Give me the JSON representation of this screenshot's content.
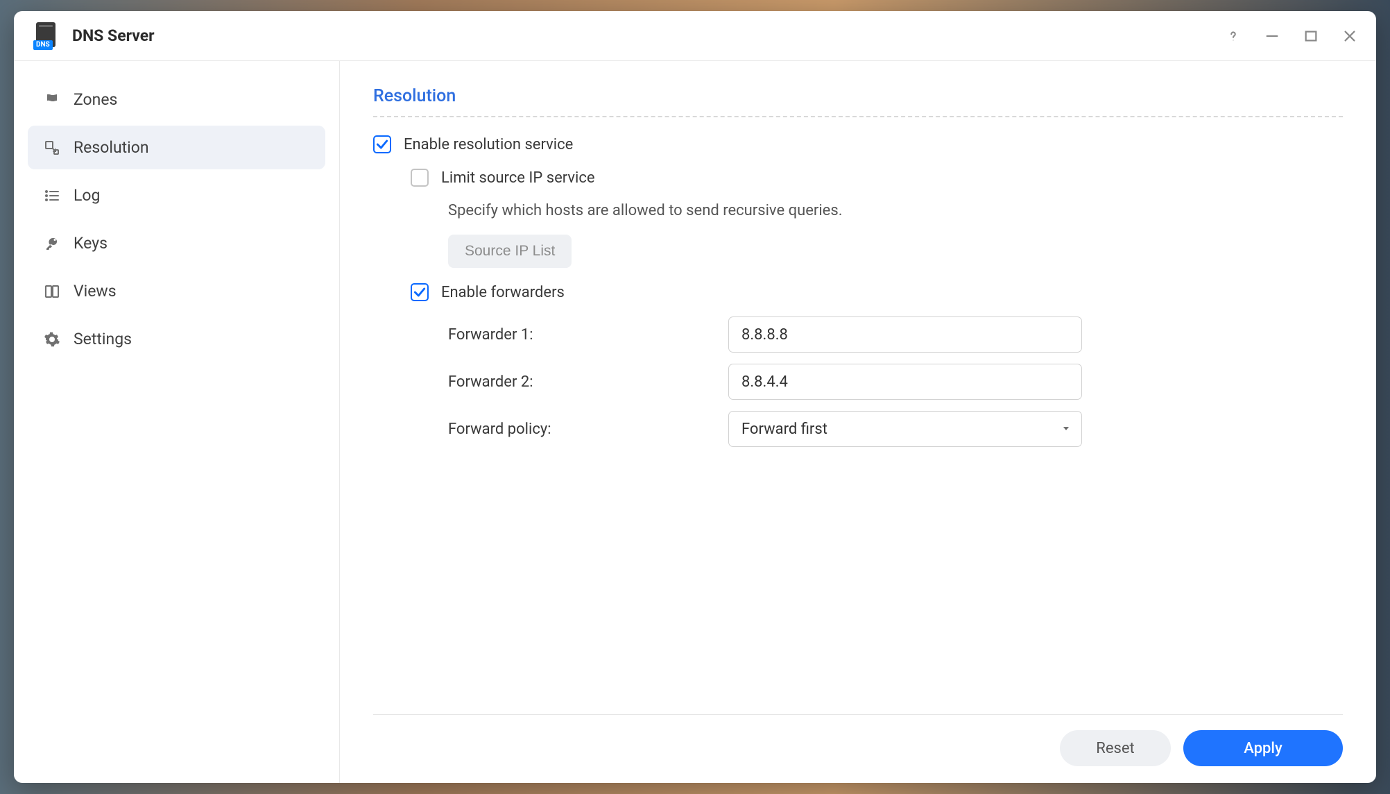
{
  "app": {
    "title": "DNS Server",
    "icon_badge": "DNS"
  },
  "sidebar": {
    "items": [
      {
        "label": "Zones"
      },
      {
        "label": "Resolution"
      },
      {
        "label": "Log"
      },
      {
        "label": "Keys"
      },
      {
        "label": "Views"
      },
      {
        "label": "Settings"
      }
    ],
    "active_index": 1
  },
  "section": {
    "title": "Resolution"
  },
  "form": {
    "enable_resolution": {
      "label": "Enable resolution service",
      "checked": true
    },
    "limit_source_ip": {
      "label": "Limit source IP service",
      "checked": false
    },
    "limit_help": "Specify which hosts are allowed to send recursive queries.",
    "source_ip_list_btn": "Source IP List",
    "enable_forwarders": {
      "label": "Enable forwarders",
      "checked": true
    },
    "forwarder1": {
      "label": "Forwarder 1:",
      "value": "8.8.8.8"
    },
    "forwarder2": {
      "label": "Forwarder 2:",
      "value": "8.8.4.4"
    },
    "forward_policy": {
      "label": "Forward policy:",
      "value": "Forward first"
    }
  },
  "footer": {
    "reset": "Reset",
    "apply": "Apply"
  }
}
